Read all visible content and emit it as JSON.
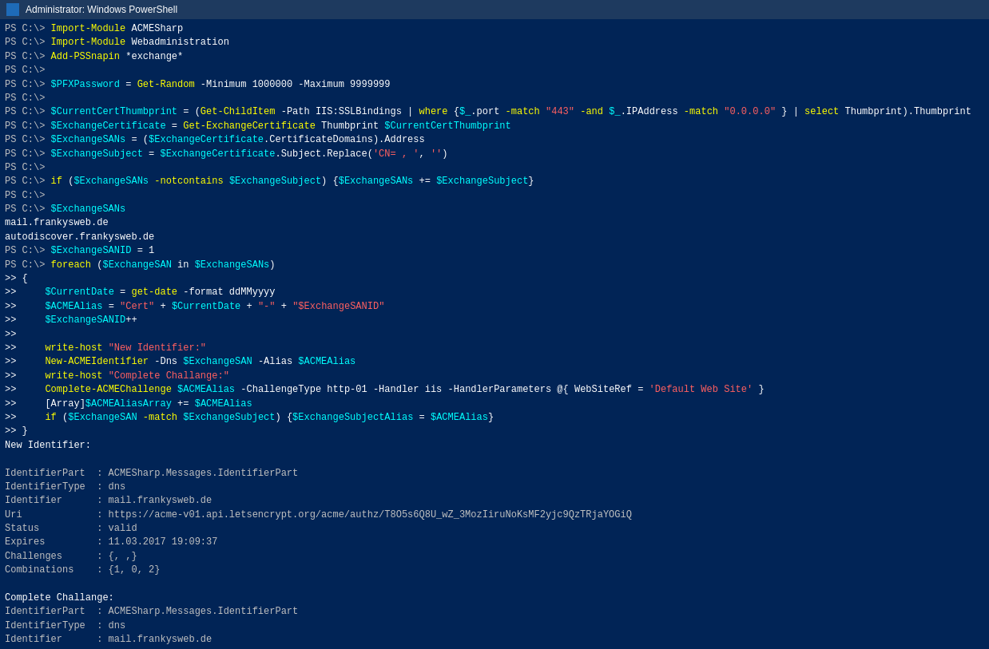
{
  "titleBar": {
    "title": "Administrator: Windows PowerShell",
    "icon": "powershell-icon"
  },
  "terminal": {
    "lines": []
  }
}
